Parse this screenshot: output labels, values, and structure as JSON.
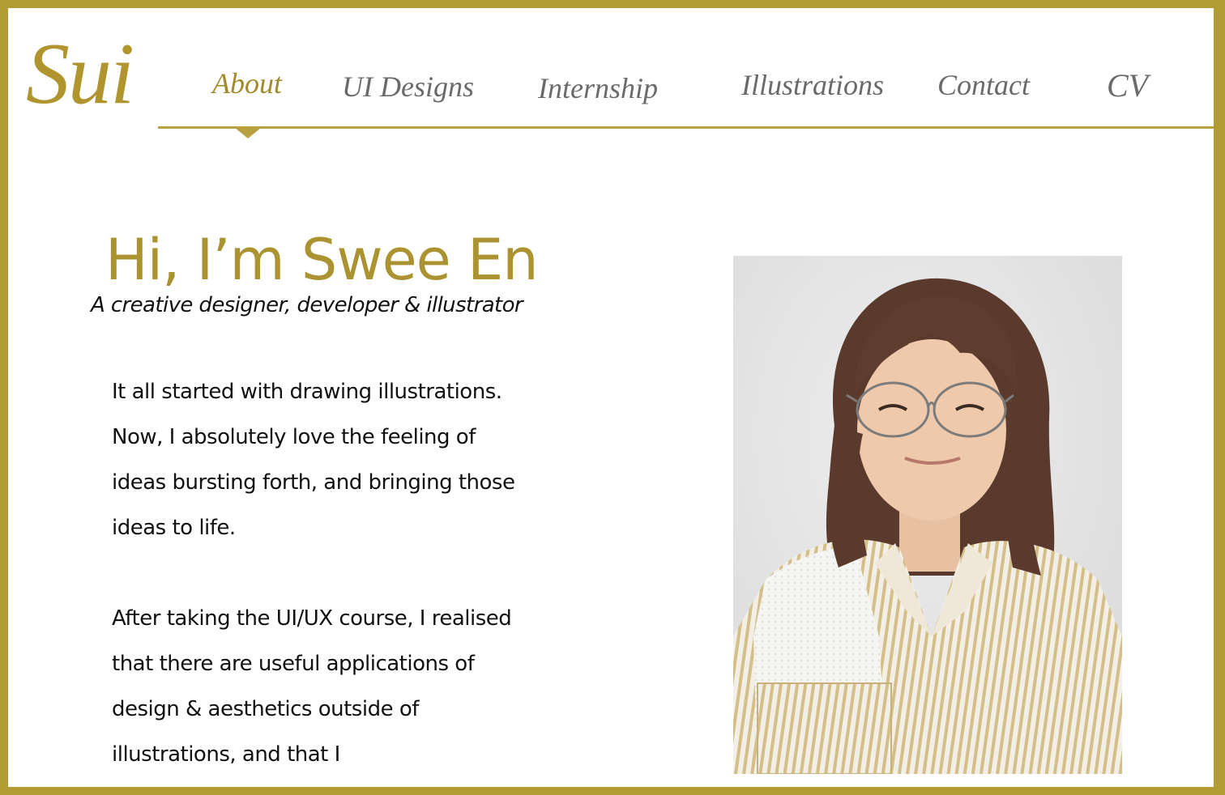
{
  "logo": "Sui",
  "nav": {
    "items": [
      {
        "label": "About",
        "active": true
      },
      {
        "label": "UI Designs",
        "active": false
      },
      {
        "label": "Internship",
        "active": false
      },
      {
        "label": "Illustrations",
        "active": false
      },
      {
        "label": "Contact",
        "active": false
      },
      {
        "label": "CV",
        "active": false
      }
    ]
  },
  "hero": {
    "greeting": "Hi, I’m Swee En",
    "tagline": "A creative designer, developer & illustrator"
  },
  "about": {
    "paragraph1": "It all started with drawing illustrations. Now, I absolutely love the feeling of ideas bursting forth, and bringing those ideas to life.",
    "paragraph2": "After taking the UI/UX course, I realised that there are useful applications of design & aesthetics outside of illustrations, and that I"
  },
  "colors": {
    "accent": "#b29b32",
    "nav_text": "#6a6a6a",
    "body_text": "#111111"
  },
  "icons": {
    "nav_active_marker": "triangle-down-icon"
  }
}
